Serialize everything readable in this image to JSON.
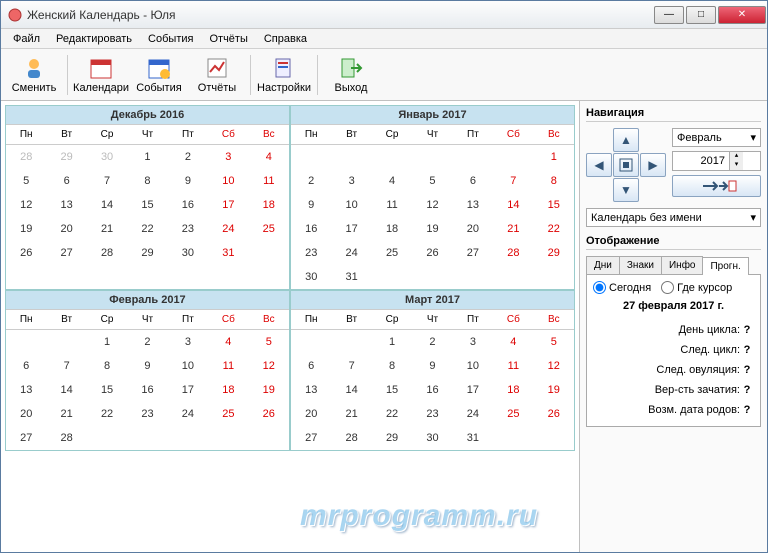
{
  "window": {
    "title": "Женский Календарь - Юля"
  },
  "menu": {
    "file": "Файл",
    "edit": "Редактировать",
    "events": "События",
    "reports": "Отчёты",
    "help": "Справка"
  },
  "toolbar": {
    "change": "Сменить",
    "calendars": "Календари",
    "events": "События",
    "reports": "Отчёты",
    "settings": "Настройки",
    "exit": "Выход"
  },
  "dow": [
    "Пн",
    "Вт",
    "Ср",
    "Чт",
    "Пт",
    "Сб",
    "Вс"
  ],
  "months": [
    {
      "title": "Декабрь  2016",
      "lead": [
        28,
        29,
        30
      ],
      "days": 31,
      "trail": 0
    },
    {
      "title": "Январь  2017",
      "lead": [
        0,
        0,
        0,
        0,
        0,
        0
      ],
      "days": 31,
      "trail": 0
    },
    {
      "title": "Февраль  2017",
      "lead": [
        0,
        0
      ],
      "days": 28,
      "trail": 0
    },
    {
      "title": "Март  2017",
      "lead": [
        0,
        0
      ],
      "days": 31,
      "trail": 0
    }
  ],
  "nav": {
    "title": "Навигация",
    "month": "Февраль",
    "year": "2017",
    "calselect": "Календарь без имени"
  },
  "disp": {
    "title": "Отображение",
    "tabs": {
      "days": "Дни",
      "signs": "Знаки",
      "info": "Инфо",
      "prog": "Прогн."
    },
    "radio_today": "Сегодня",
    "radio_cursor": "Где курсор",
    "date": "27 февраля 2017 г.",
    "rows": {
      "cycle_day": "День цикла:",
      "next_cycle": "След. цикл:",
      "next_ov": "След. овуляция:",
      "conc_prob": "Вер-сть зачатия:",
      "due_date": "Возм. дата родов:"
    },
    "q": "?"
  },
  "watermark": "mrprogramm.ru"
}
